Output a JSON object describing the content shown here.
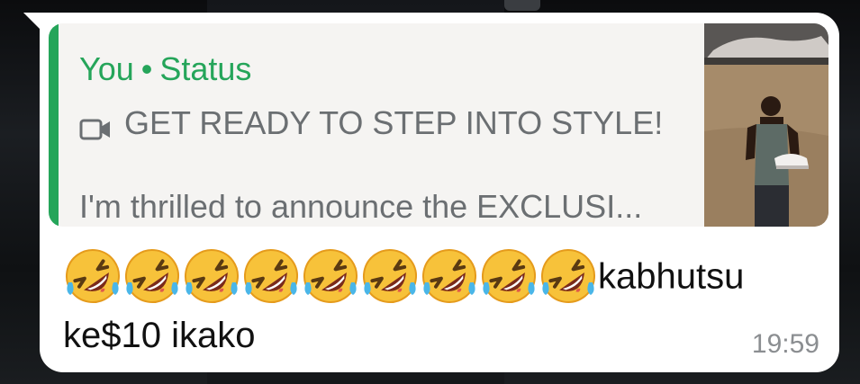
{
  "quote": {
    "author": "You",
    "separator": "•",
    "type": "Status",
    "media_icon": "video-camera-icon",
    "line1": "GET READY TO STEP INTO STYLE!",
    "line2": "I'm thrilled to announce the EXCLUSI..."
  },
  "message": {
    "emoji": "rolling-on-the-floor-laughing-emoji",
    "emoji_count": 9,
    "text_word1": "kabhutsu",
    "text_line2": "ke$10 ikako",
    "time": "19:59"
  },
  "colors": {
    "accent_green": "#25a55a",
    "bubble": "#ffffff",
    "quote_bg": "#f5f4f2",
    "muted_text": "#6b6f72",
    "time_text": "#8b8e91"
  }
}
